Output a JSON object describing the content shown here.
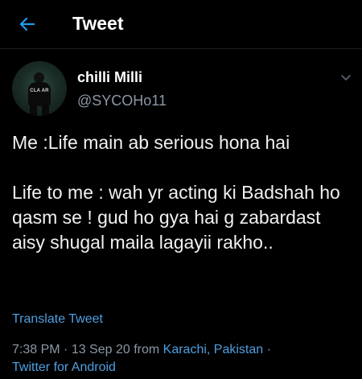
{
  "header": {
    "title": "Tweet",
    "back_icon": "arrow-left-icon",
    "accent_color": "#1d9bf0"
  },
  "tweet": {
    "author": {
      "display_name": "chilli Milli",
      "handle": "@SYCOHo11",
      "avatar_text": "CLA AR"
    },
    "text": {
      "paragraph_1": "Me :Life main ab serious hona hai",
      "paragraph_2": "Life to me : wah yr acting ki Badshah ho qasm se ! gud ho gya hai g zabardast aisy shugal maila lagayii rakho.."
    },
    "translate_label": "Translate Tweet",
    "meta": {
      "time": "7:38 PM",
      "separator_1": " · ",
      "date": "13 Sep 20",
      "from_label": " from ",
      "location": "Karachi, Pakistan",
      "separator_2": " · ",
      "source": "Twitter for Android"
    },
    "menu_icon": "chevron-down-icon"
  }
}
